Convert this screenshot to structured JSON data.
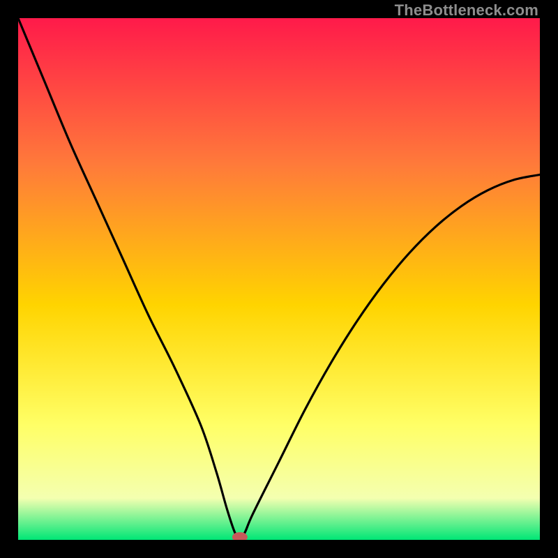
{
  "watermark": "TheBottleneck.com",
  "colors": {
    "frame": "#000000",
    "gradient_top": "#ff1a4a",
    "gradient_mid1": "#ff7a3a",
    "gradient_mid2": "#ffd400",
    "gradient_mid3": "#ffff66",
    "gradient_mid4": "#f4ffb0",
    "gradient_bottom": "#00e676",
    "curve": "#000000",
    "marker": "#c75a5a"
  },
  "chart_data": {
    "type": "line",
    "title": "",
    "xlabel": "",
    "ylabel": "",
    "xrange": [
      0,
      100
    ],
    "ylim": [
      0,
      100
    ],
    "series": [
      {
        "name": "bottleneck-curve",
        "x": [
          0,
          5,
          10,
          15,
          20,
          25,
          30,
          35,
          38,
          40,
          41.5,
          42.5,
          43.5,
          45,
          50,
          55,
          60,
          65,
          70,
          75,
          80,
          85,
          90,
          95,
          100
        ],
        "values": [
          100,
          88,
          76,
          65,
          54,
          43,
          33,
          22,
          13,
          6,
          1.5,
          0,
          1.5,
          5,
          15,
          25,
          34,
          42,
          49,
          55,
          60,
          64,
          67,
          69,
          70
        ]
      }
    ],
    "marker": {
      "x": 42.5,
      "y": 0,
      "label": "optimal-point"
    }
  }
}
